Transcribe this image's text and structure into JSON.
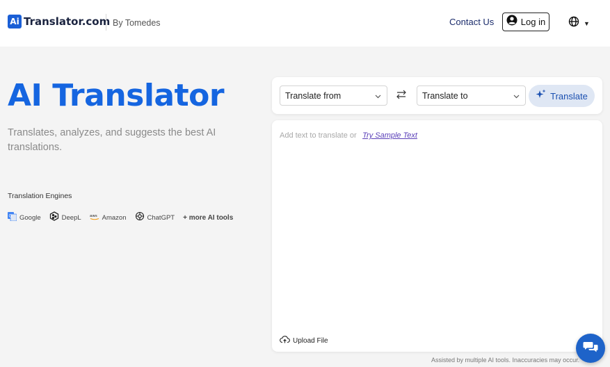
{
  "header": {
    "logo_badge": "Ai",
    "logo_text": "Translator.com",
    "by_text": "By Tomedes",
    "contact_label": "Contact Us",
    "login_label": "Log in"
  },
  "hero": {
    "title": "AI Translator",
    "subtitle": "Translates, analyzes, and suggests the best AI translations.",
    "engines_label": "Translation Engines",
    "engines": [
      {
        "name": "Google",
        "icon": "google-translate-icon"
      },
      {
        "name": "DeepL",
        "icon": "deepl-icon"
      },
      {
        "name": "Amazon",
        "icon": "aws-icon"
      },
      {
        "name": "ChatGPT",
        "icon": "chatgpt-icon"
      }
    ],
    "more_tools": "+ more AI tools"
  },
  "translator": {
    "from_label": "Translate from",
    "to_label": "Translate to",
    "translate_label": "Translate",
    "placeholder": "Add text to translate or",
    "sample_link": "Try Sample Text",
    "upload_label": "Upload File"
  },
  "disclaimer": "Assisted by multiple AI tools. Inaccuracies may occur.",
  "colors": {
    "brand_blue": "#1565e0",
    "translate_button_bg": "#dfe7f4",
    "chat_button": "#1e63c9"
  }
}
